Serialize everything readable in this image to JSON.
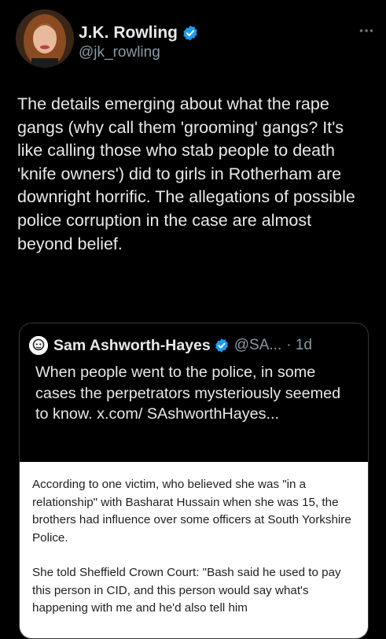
{
  "author": {
    "name": "J.K. Rowling",
    "handle": "@jk_rowling",
    "more_icon": "more-horizontal-icon"
  },
  "tweet": {
    "text": "The details emerging about what the rape gangs (why call them 'grooming' gangs? It's like calling those who stab people to death 'knife owners') did to girls in Rotherham are downright horrific. The allegations of possible police corruption in the case are almost beyond belief."
  },
  "quoted": {
    "name": "Sam Ashworth-Hayes",
    "handle": "@SA...",
    "time": "· 1d",
    "text": "When people went to the police, in some cases the perpetrators mysteriously seemed to know. x.com/ SAshworthHayes...",
    "image_paragraphs": [
      "According to one victim, who believed she was \"in a relationship\" with Basharat Hussain when she was 15, the brothers had influence over some officers at South Yorkshire Police.",
      "She told Sheffield Crown Court: \"Bash said he used to pay this person in CID, and this person would say what's happening with me and he'd also tell him"
    ]
  },
  "colors": {
    "background": "#000000",
    "text": "#e7e9ea",
    "secondary": "#8b98a5",
    "verified": "#1d9bf0"
  }
}
